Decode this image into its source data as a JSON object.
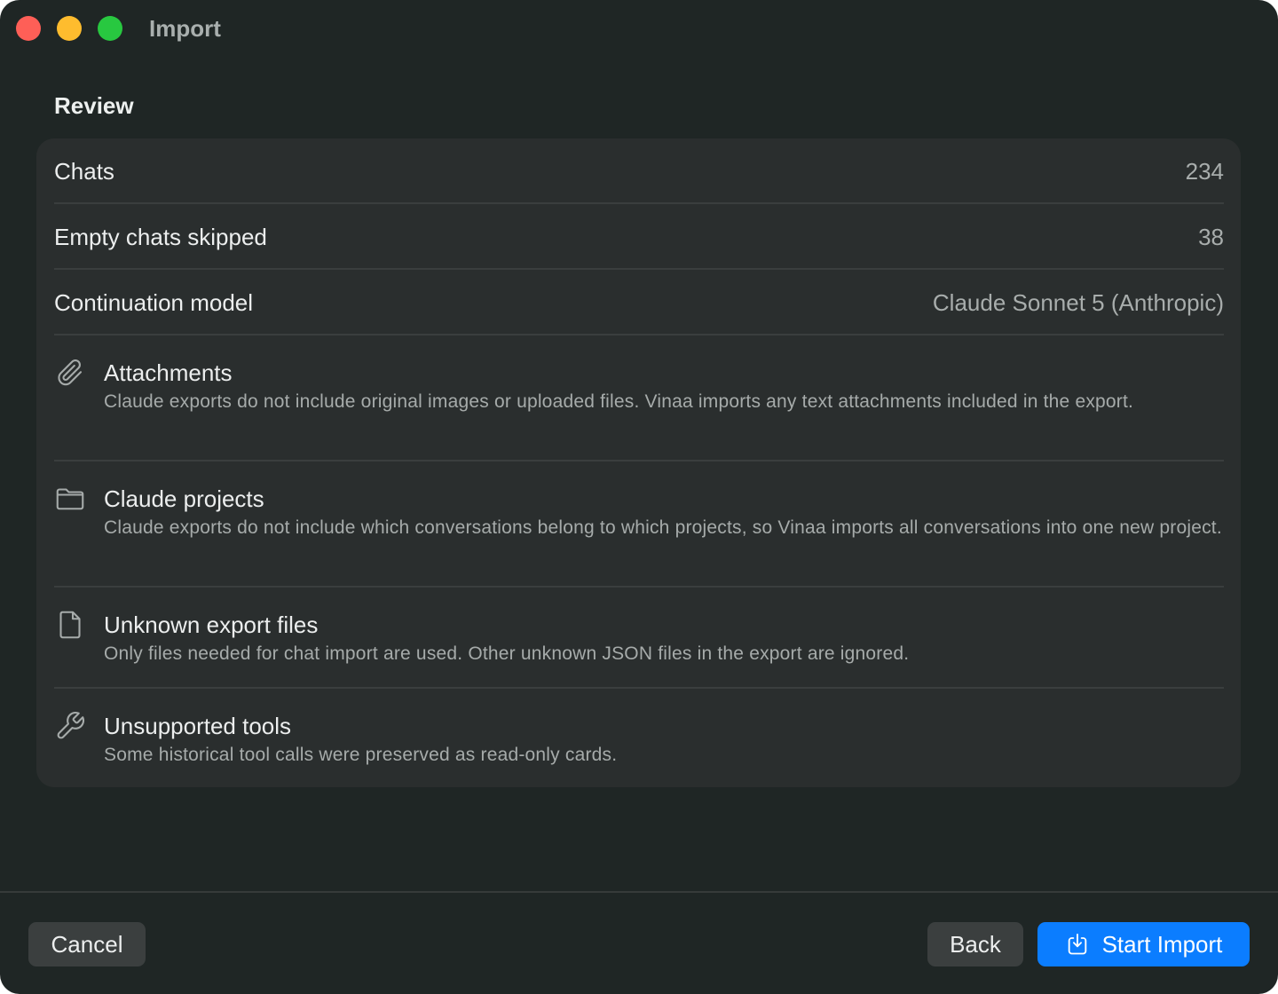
{
  "window": {
    "title": "Import"
  },
  "review": {
    "heading": "Review",
    "rows": [
      {
        "label": "Chats",
        "value": "234"
      },
      {
        "label": "Empty chats skipped",
        "value": "38"
      },
      {
        "label": "Continuation model",
        "value": "Claude Sonnet 5 (Anthropic)"
      }
    ],
    "notes": [
      {
        "icon": "paperclip-icon",
        "title": "Attachments",
        "body": "Claude exports do not include original images or uploaded files. Vinaa imports any text attachments included in the export."
      },
      {
        "icon": "folder-icon",
        "title": "Claude projects",
        "body": "Claude exports do not include which conversations belong to which projects, so Vinaa imports all conversations into one new project."
      },
      {
        "icon": "document-icon",
        "title": "Unknown export files",
        "body": "Only files needed for chat import are used. Other unknown JSON files in the export are ignored."
      },
      {
        "icon": "wrench-icon",
        "title": "Unsupported tools",
        "body": "Some historical tool calls were preserved as read-only cards."
      }
    ]
  },
  "footer": {
    "cancel_label": "Cancel",
    "back_label": "Back",
    "start_label": "Start Import",
    "start_icon": "import-icon"
  },
  "colors": {
    "window_background": "#1f2625",
    "card_background": "#2a2e2e",
    "primary_button": "#0b7dff",
    "secondary_button": "#3b3f3f",
    "close_light": "#fe5f57",
    "minimize_light": "#febc2e",
    "zoom_light": "#28c840"
  }
}
